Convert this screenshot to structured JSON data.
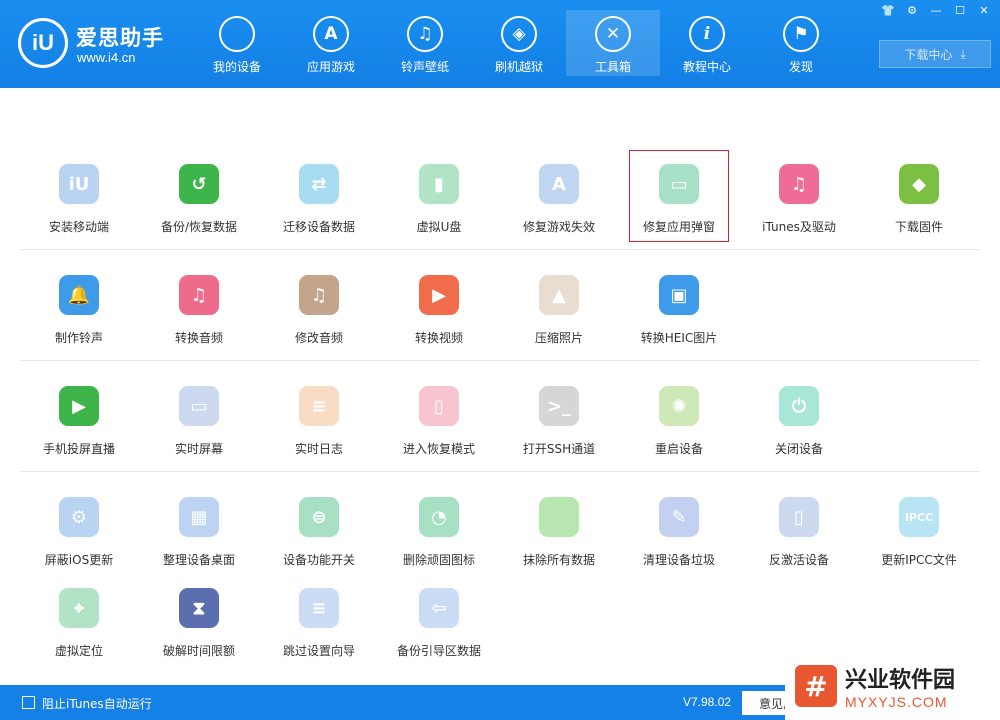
{
  "app": {
    "logo_text": "iU",
    "title": "爱思助手",
    "url": "www.i4.cn"
  },
  "nav": [
    {
      "label": "我的设备",
      "icon": "apple-icon",
      "glyph": ""
    },
    {
      "label": "应用游戏",
      "icon": "app-store-icon",
      "glyph": "A"
    },
    {
      "label": "铃声壁纸",
      "icon": "ringtone-icon",
      "glyph": "♫"
    },
    {
      "label": "刷机越狱",
      "icon": "dropbox-icon",
      "glyph": "◈"
    },
    {
      "label": "工具箱",
      "icon": "toolbox-icon",
      "glyph": "✕",
      "active": true
    },
    {
      "label": "教程中心",
      "icon": "info-icon",
      "glyph": "i"
    },
    {
      "label": "发现",
      "icon": "flag-icon",
      "glyph": "⚑"
    }
  ],
  "window_controls": [
    "shirt-icon",
    "settings-icon",
    "minimize-icon",
    "maximize-icon",
    "close-icon"
  ],
  "download_center": {
    "label": "下载中心",
    "icon": "download-icon"
  },
  "tools": [
    [
      {
        "label": "安装移动端",
        "color": "#b9d3f2",
        "glyph": "iU",
        "icon": "i4-mobile-icon"
      },
      {
        "label": "备份/恢复数据",
        "color": "#3db54a",
        "glyph": "↺",
        "icon": "backup-restore-icon"
      },
      {
        "label": "迁移设备数据",
        "color": "#a8dcf3",
        "glyph": "⇄",
        "icon": "migrate-data-icon"
      },
      {
        "label": "虚拟U盘",
        "color": "#b2e3c6",
        "glyph": "▮",
        "icon": "usb-drive-icon"
      },
      {
        "label": "修复游戏失效",
        "color": "#bfd5f2",
        "glyph": "A",
        "icon": "fix-game-icon"
      },
      {
        "label": "修复应用弹窗",
        "color": "#a8e0c8",
        "glyph": "▭",
        "icon": "fix-app-popup-icon",
        "highlight": true
      },
      {
        "label": "iTunes及驱动",
        "color": "#ef6b98",
        "glyph": "♫",
        "icon": "itunes-driver-icon"
      },
      {
        "label": "下载固件",
        "color": "#7bc043",
        "glyph": "◆",
        "icon": "download-firmware-icon"
      }
    ],
    [
      {
        "label": "制作铃声",
        "color": "#3d9be9",
        "glyph": "🔔",
        "icon": "make-ringtone-icon"
      },
      {
        "label": "转换音频",
        "color": "#ef6b8b",
        "glyph": "♫",
        "icon": "convert-audio-icon"
      },
      {
        "label": "修改音频",
        "color": "#c4a58c",
        "glyph": "♫",
        "icon": "edit-audio-icon"
      },
      {
        "label": "转换视频",
        "color": "#f06c4b",
        "glyph": "▶",
        "icon": "convert-video-icon"
      },
      {
        "label": "压缩照片",
        "color": "#e8ddd0",
        "glyph": "▲",
        "icon": "compress-photo-icon"
      },
      {
        "label": "转换HEIC图片",
        "color": "#3d9be9",
        "glyph": "▣",
        "icon": "convert-heic-icon"
      }
    ],
    [
      {
        "label": "手机投屏直播",
        "color": "#3db54a",
        "glyph": "▶",
        "icon": "screen-mirror-icon"
      },
      {
        "label": "实时屏幕",
        "color": "#cdd9ee",
        "glyph": "▭",
        "icon": "realtime-screen-icon"
      },
      {
        "label": "实时日志",
        "color": "#f8dcc4",
        "glyph": "≡",
        "icon": "realtime-log-icon"
      },
      {
        "label": "进入恢复模式",
        "color": "#f7c4d0",
        "glyph": "▯",
        "icon": "recovery-mode-icon"
      },
      {
        "label": "打开SSH通道",
        "color": "#d6d6d6",
        "glyph": ">_",
        "icon": "ssh-channel-icon"
      },
      {
        "label": "重启设备",
        "color": "#cfe8b8",
        "glyph": "✺",
        "icon": "reboot-device-icon"
      },
      {
        "label": "关闭设备",
        "color": "#a8e6d8",
        "glyph": "⏻",
        "icon": "shutdown-device-icon"
      }
    ],
    [
      {
        "label": "屏蔽iOS更新",
        "color": "#b9d3f2",
        "glyph": "⚙",
        "icon": "block-ios-update-icon"
      },
      {
        "label": "整理设备桌面",
        "color": "#bcd4f2",
        "glyph": "▦",
        "icon": "organize-desktop-icon"
      },
      {
        "label": "设备功能开关",
        "color": "#a8e0c4",
        "glyph": "⊜",
        "icon": "feature-switch-icon"
      },
      {
        "label": "删除顽固图标",
        "color": "#a8e0c4",
        "glyph": "◔",
        "icon": "delete-icons-icon"
      },
      {
        "label": "抹除所有数据",
        "color": "#b8e6b0",
        "glyph": "",
        "icon": "erase-data-icon"
      },
      {
        "label": "清理设备垃圾",
        "color": "#c4d0f0",
        "glyph": "✎",
        "icon": "clean-junk-icon"
      },
      {
        "label": "反激活设备",
        "color": "#cdd9ee",
        "glyph": "▯",
        "icon": "deactivate-device-icon"
      },
      {
        "label": "更新IPCC文件",
        "color": "#b8e4f4",
        "glyph": "IPCC",
        "icon": "update-ipcc-icon"
      }
    ],
    [
      {
        "label": "虚拟定位",
        "color": "#b2e3c6",
        "glyph": "⌖",
        "icon": "virtual-location-icon"
      },
      {
        "label": "破解时间限额",
        "color": "#5b6fae",
        "glyph": "⧗",
        "icon": "crack-time-limit-icon"
      },
      {
        "label": "跳过设置向导",
        "color": "#c9dcf4",
        "glyph": "≡",
        "icon": "skip-setup-icon"
      },
      {
        "label": "备份引导区数据",
        "color": "#c9dcf4",
        "glyph": "⇦",
        "icon": "backup-boot-icon"
      }
    ]
  ],
  "statusbar": {
    "checkbox_label": "阻止iTunes自动运行",
    "version": "V7.98.02",
    "feedback_label": "意见反"
  },
  "watermark": {
    "mark": "#",
    "title": "兴业软件园",
    "url": "MYXYJS.COM"
  }
}
